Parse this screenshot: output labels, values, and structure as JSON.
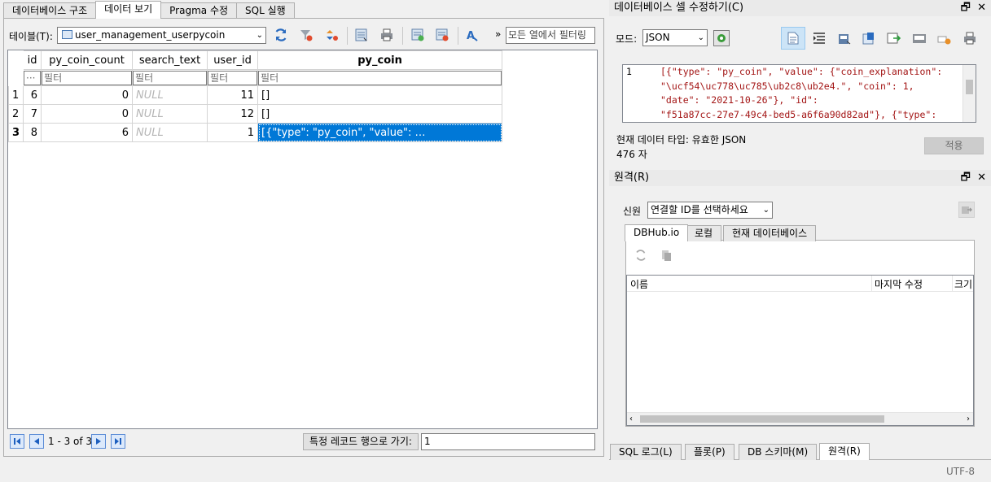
{
  "tabs": [
    "데이터베이스 구조",
    "데이터 보기",
    "Pragma 수정",
    "SQL 실행"
  ],
  "active_tab": 1,
  "toolbar": {
    "table_label": "테이블(T):",
    "table_value": "user_management_userpycoin",
    "more": "»",
    "filter_placeholder": "모든 열에서 필터링"
  },
  "grid": {
    "columns": [
      "id",
      "py_coin_count",
      "search_text",
      "user_id",
      "py_coin"
    ],
    "filter_placeholder": "필터",
    "filter_first": "···",
    "rows": [
      {
        "rownum": "1",
        "id": "6",
        "py_coin_count": "0",
        "search_text": "NULL",
        "user_id": "11",
        "py_coin": "[]"
      },
      {
        "rownum": "2",
        "id": "7",
        "py_coin_count": "0",
        "search_text": "NULL",
        "user_id": "12",
        "py_coin": "[]"
      },
      {
        "rownum": "3",
        "id": "8",
        "py_coin_count": "6",
        "search_text": "NULL",
        "user_id": "1",
        "py_coin": "[{\"type\": \"py_coin\", \"value\": …"
      }
    ]
  },
  "nav": {
    "range": "1 - 3 of 3",
    "goto_label": "특정 레코드 행으로 가기:",
    "goto_value": "1"
  },
  "cell_editor": {
    "title": "데이터베이스 셀 수정하기(C)",
    "mode_label": "모드:",
    "mode_value": "JSON",
    "line_number": "1",
    "code_lines": [
      "[{\"type\": \"py_coin\", \"value\": {\"coin_explanation\":",
      "\"\\ucf54\\uc778\\uc785\\ub2c8\\ub2e4.\", \"coin\": 1,",
      "\"date\": \"2021-10-26\"}, \"id\":",
      "\"f51a87cc-27e7-49c4-bed5-a6f6a90d82ad\"}, {\"type\":"
    ],
    "data_type": "현재 데이터 타입: 유효한 JSON",
    "size": "476 자",
    "apply": "적용"
  },
  "remote": {
    "title": "원격(R)",
    "identity_label": "신원",
    "identity_value": "연결할 ID를 선택하세요",
    "tabs": [
      "DBHub.io",
      "로컬",
      "현재 데이터베이스"
    ],
    "columns": [
      "이름",
      "마지막 수정",
      "크기"
    ]
  },
  "bottom_tabs": [
    "SQL 로그(L)",
    "플롯(P)",
    "DB 스키마(M)",
    "원격(R)"
  ],
  "status": {
    "encoding": "UTF-8"
  },
  "panel_controls": {
    "float": "🗗",
    "close": "✕"
  }
}
